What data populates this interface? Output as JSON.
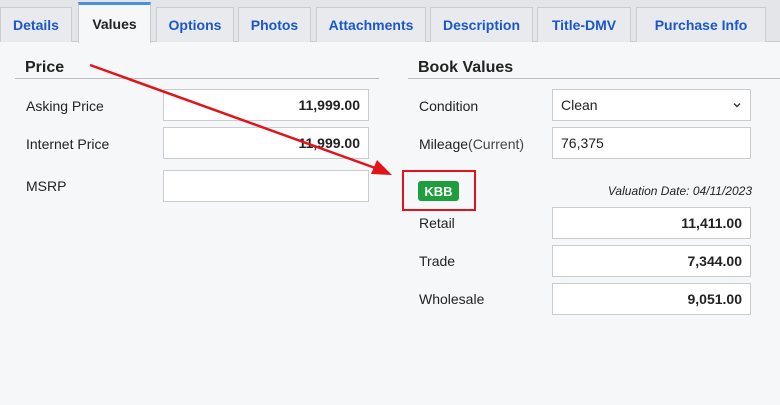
{
  "tabs": [
    {
      "label": "Details"
    },
    {
      "label": "Values",
      "active": true
    },
    {
      "label": "Options"
    },
    {
      "label": "Photos"
    },
    {
      "label": "Attachments"
    },
    {
      "label": "Description"
    },
    {
      "label": "Title-DMV"
    },
    {
      "label": "Purchase Info"
    }
  ],
  "price": {
    "title": "Price",
    "asking_label": "Asking Price",
    "asking_value": "11,999.00",
    "internet_label": "Internet Price",
    "internet_value": "11,999.00",
    "msrp_label": "MSRP",
    "msrp_value": ""
  },
  "book": {
    "title": "Book Values",
    "condition_label": "Condition",
    "condition_value": "Clean",
    "mileage_label": "Mileage",
    "mileage_sub": "(Current)",
    "mileage_value": "76,375",
    "kbb_label": "KBB",
    "valuation_date": "Valuation Date: 04/11/2023",
    "retail_label": "Retail",
    "retail_value": "11,411.00",
    "trade_label": "Trade",
    "trade_value": "7,344.00",
    "wholesale_label": "Wholesale",
    "wholesale_value": "9,051.00"
  },
  "colors": {
    "tab_text": "#1a57c9",
    "active_tab_accent": "#4a90e2",
    "kbb_badge": "#1f9e3e",
    "annotation": "#e0141a"
  }
}
